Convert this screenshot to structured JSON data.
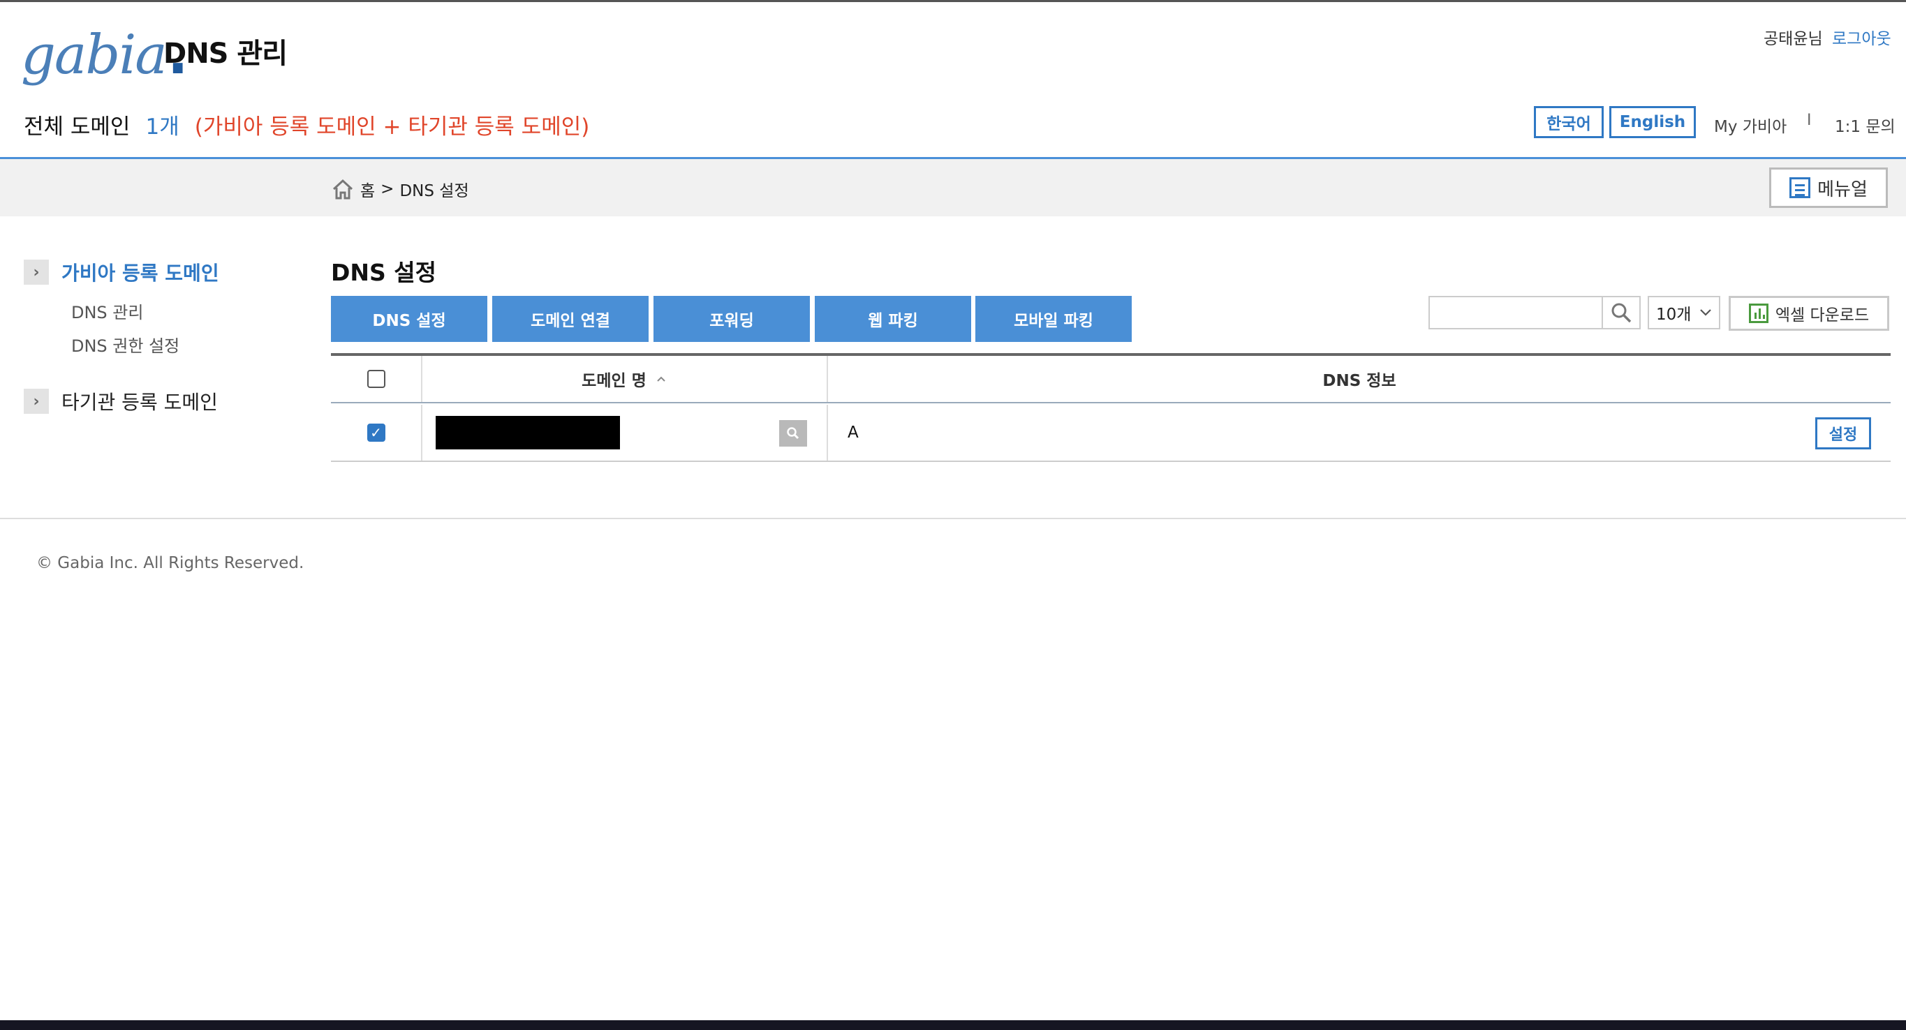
{
  "header": {
    "logo_text": "gabia",
    "app_title": "DNS 관리",
    "user_name": "공태윤님",
    "logout_label": "로그아웃",
    "summary_label": "전체 도메인",
    "summary_count": "1개",
    "summary_note": "(가비아 등록 도메인 + 타기관 등록 도메인)",
    "lang_korean": "한국어",
    "lang_english": "English",
    "my_gabia": "My 가비아",
    "separator": "I",
    "inquiry": "1:1 문의"
  },
  "breadcrumb": {
    "home": "홈",
    "arrow": ">",
    "current": "DNS 설정",
    "manual_label": "메뉴얼"
  },
  "sidebar": {
    "sections": [
      {
        "label": "가비아 등록 도메인",
        "active": true,
        "items": [
          "DNS 관리",
          "DNS 권한 설정"
        ]
      },
      {
        "label": "타기관 등록 도메인",
        "active": false,
        "items": []
      }
    ]
  },
  "main": {
    "title": "DNS 설정",
    "tabs": [
      "DNS 설정",
      "도메인 연결",
      "포워딩",
      "웹 파킹",
      "모바일 파킹"
    ],
    "search_value": "",
    "page_size": "10개",
    "excel_label": "엑셀 다운로드",
    "table": {
      "headers": [
        "도메인 명",
        "DNS 정보"
      ],
      "sort_indicator": "^",
      "rows": [
        {
          "checked": true,
          "domain": "",
          "dns_info": "A",
          "action": "설정"
        }
      ]
    }
  },
  "footer": {
    "copyright": "© Gabia Inc. All Rights Reserved."
  },
  "colors": {
    "accent": "#2f78c4",
    "tab_bg": "#4a8fd6",
    "note": "#e0452a"
  }
}
